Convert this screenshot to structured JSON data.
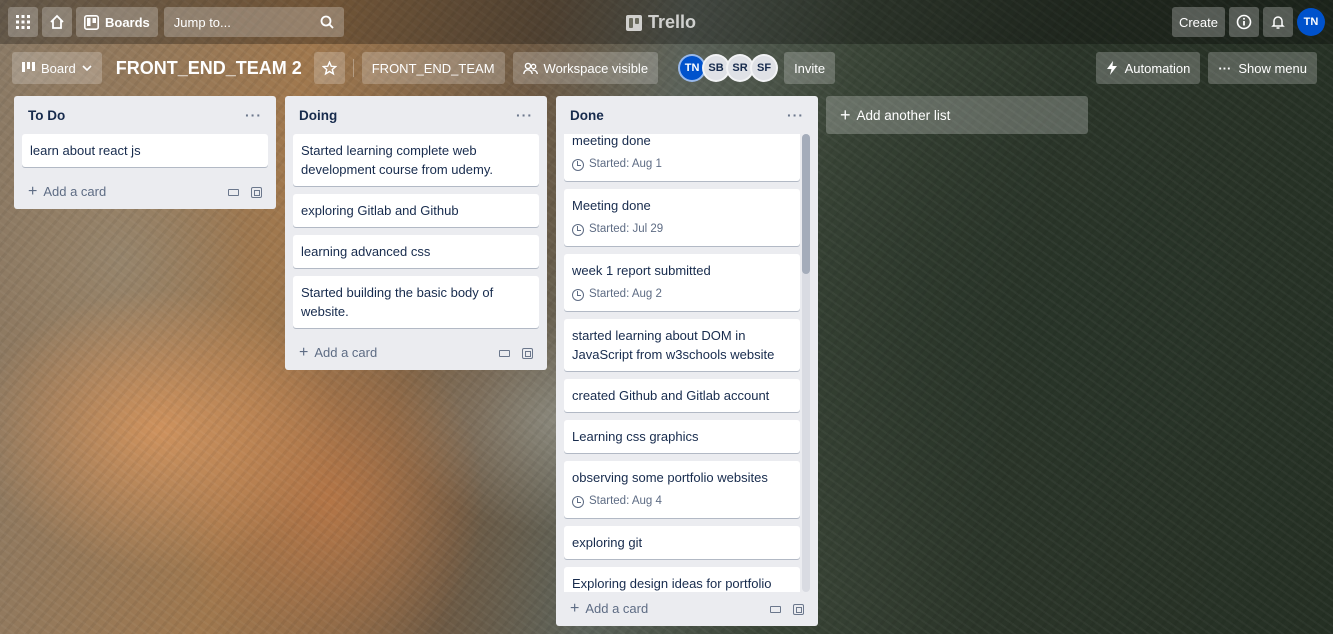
{
  "topbar": {
    "boards_label": "Boards",
    "search_placeholder": "Jump to...",
    "logo_text": "Trello",
    "create_label": "Create",
    "avatar_initials": "TN"
  },
  "board": {
    "view_label": "Board",
    "title": "FRONT_END_TEAM 2",
    "workspace_label": "FRONT_END_TEAM",
    "visibility_label": "Workspace visible",
    "members": [
      "TN",
      "SB",
      "SR",
      "SF"
    ],
    "invite_label": "Invite",
    "automation_label": "Automation",
    "show_menu_label": "Show menu"
  },
  "lists": [
    {
      "title": "To Do",
      "cards": [
        {
          "text": "learn about react js"
        }
      ],
      "add_label": "Add a card"
    },
    {
      "title": "Doing",
      "cards": [
        {
          "text": "Started learning complete web development course from udemy."
        },
        {
          "text": "exploring Gitlab and Github"
        },
        {
          "text": "learning advanced css"
        },
        {
          "text": "Started building the basic body of website."
        }
      ],
      "add_label": "Add a card"
    },
    {
      "title": "Done",
      "cards": [
        {
          "text": "meeting done",
          "badge": "Started: Aug 1"
        },
        {
          "text": "Meeting done",
          "badge": "Started: Jul 29"
        },
        {
          "text": "week 1 report submitted",
          "badge": "Started: Aug 2"
        },
        {
          "text": "started learning about DOM in JavaScript from w3schools website"
        },
        {
          "text": "created Github and Gitlab account"
        },
        {
          "text": "Learning css graphics"
        },
        {
          "text": "observing some portfolio websites",
          "badge": "Started: Aug 4"
        },
        {
          "text": "exploring git"
        },
        {
          "text": "Exploring design ideas for portfolio"
        }
      ],
      "add_label": "Add a card"
    }
  ],
  "add_list_label": "Add another list",
  "colors": {
    "accent": "#0052cc",
    "list_bg": "#ebecf0",
    "card_bg": "#ffffff"
  }
}
